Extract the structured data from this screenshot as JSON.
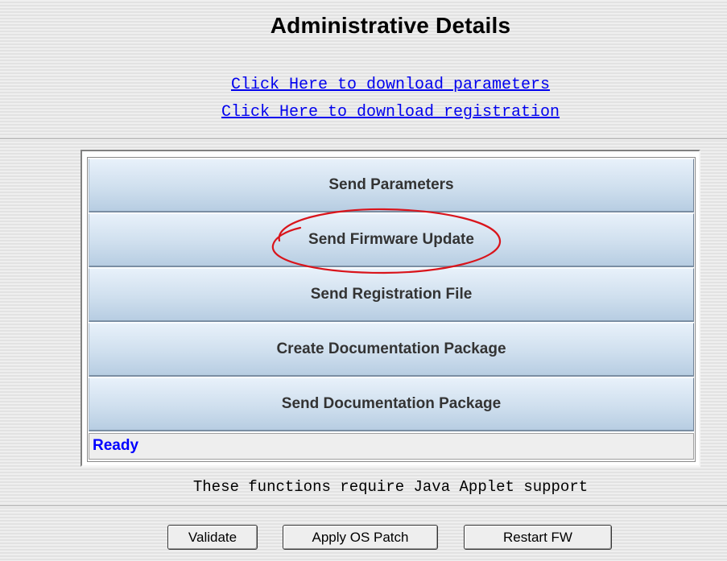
{
  "header": {
    "title": "Administrative Details"
  },
  "links": {
    "download_parameters": "Click Here to download parameters",
    "download_registration": "Click Here to download registration"
  },
  "applet": {
    "buttons": [
      {
        "label": "Send Parameters"
      },
      {
        "label": "Send Firmware Update",
        "highlighted": true
      },
      {
        "label": "Send Registration File"
      },
      {
        "label": "Create Documentation Package"
      },
      {
        "label": "Send Documentation Package"
      }
    ],
    "status": "Ready"
  },
  "note": "These functions require Java Applet support",
  "footer": {
    "validate_label": "Validate",
    "apply_patch_label": "Apply OS Patch",
    "restart_label": "Restart FW"
  },
  "colors": {
    "link": "#0000ee",
    "status_text": "#0000ff",
    "highlight_ellipse": "#d9141b",
    "button_gradient_top": "#e8f1fa",
    "button_gradient_bottom": "#b7cde2"
  }
}
